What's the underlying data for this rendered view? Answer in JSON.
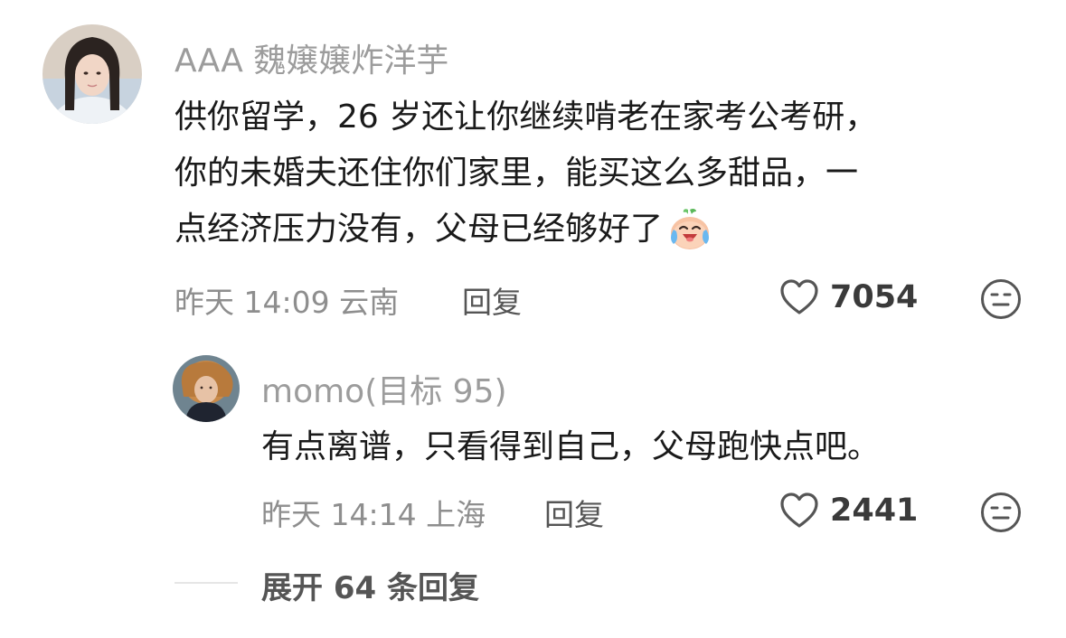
{
  "comment": {
    "username": "AAA 魏嬢嬢炸洋芋",
    "lines": [
      "供你留学，26 岁还让你继续啃老在家考公考研，",
      "你的未婚夫还住你们家里，能买这么多甜品，一",
      "点经济压力没有，父母已经够好了"
    ],
    "emoji": "crying-laugh-emoji",
    "time_location": "昨天 14:09 云南",
    "reply_label": "回复",
    "likes": "7054"
  },
  "reply": {
    "username": "momo(目标 95)",
    "text": "有点离谱，只看得到自己，父母跑快点吧。",
    "time_location": "昨天 14:14 上海",
    "reply_label": "回复",
    "likes": "2441"
  },
  "expand_label": "展开 64 条回复",
  "icons": {
    "like": "heart-outline-icon",
    "dislike": "meh-face-icon"
  },
  "colors": {
    "username": "#9c9c9c",
    "text": "#1a1a1a",
    "meta": "#8e8e8e",
    "icon": "#555555"
  }
}
